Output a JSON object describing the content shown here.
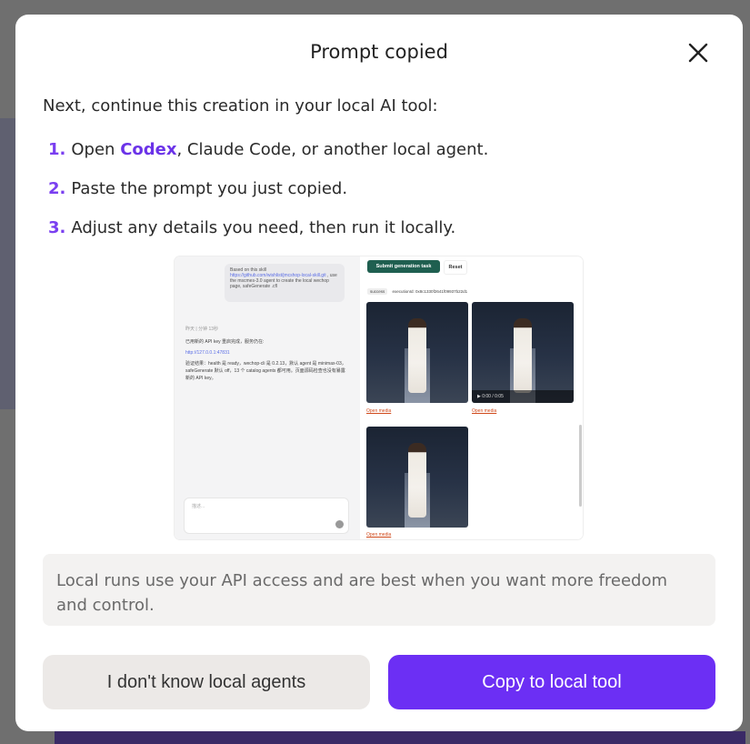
{
  "dialog": {
    "title": "Prompt copied",
    "intro": "Next, continue this creation in your local AI tool:",
    "steps": [
      {
        "num": "1.",
        "prefix": "Open ",
        "highlight": "Codex",
        "suffix": ", Claude Code, or another local agent."
      },
      {
        "num": "2.",
        "text": "Paste the prompt you just copied."
      },
      {
        "num": "3.",
        "text": "Adjust any details you need, then run it locally."
      }
    ],
    "note": "Local runs use your API access and are best when you want more freedom and control.",
    "secondary_button": "I don't know local agents",
    "primary_button": "Copy to local tool"
  },
  "preview": {
    "bubble_line1": "Based on this skill",
    "bubble_link": "https://github.com/wishlist/jmcshop-local-skill.git",
    "bubble_line2": ", use the mscmes-3.0 agent to create the local wechop page, safeGenerate .cfl",
    "msg_time": "昨天 | 分钟 13秒",
    "msg_line1": "已用新的 API key 重启完成，服务仍在:",
    "msg_link": "http://127.0.0.1:47831",
    "msg_line2": "验证结果：health 是 ready，wechop-cli 是 0.2.13，默认 agent 是 minimax-03，safeGenerate 默认 off，13 个 catalog agents 都可用。页面源码检查也没有暴露新的 API key。",
    "input_placeholder": "描述...",
    "submit_label": "Submit generation task",
    "reset_label": "Reset",
    "status_chip": "success",
    "execution_id": "executionId: 0x8c1330f2641f09937b22d1",
    "video_time": "0:00 / 0:05",
    "open_media": "Open media"
  },
  "colors": {
    "accent": "#6c2ff4",
    "step_number": "#7a3ff0",
    "note_bg": "#f3f2f1",
    "secondary_bg": "#ece9e7"
  }
}
